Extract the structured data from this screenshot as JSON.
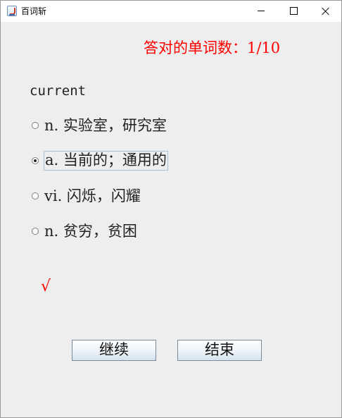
{
  "window": {
    "title": "百词斩"
  },
  "quiz": {
    "score_text": "答对的单词数：1/10",
    "word": "current",
    "options": [
      {
        "label": "n. 实验室，研究室",
        "selected": false
      },
      {
        "label": "a. 当前的；通用的",
        "selected": true
      },
      {
        "label": "vi. 闪烁，闪耀",
        "selected": false
      },
      {
        "label": "n. 贫穷，贫困",
        "selected": false
      }
    ],
    "result_mark": "√"
  },
  "buttons": {
    "continue_label": "继续",
    "end_label": "结束"
  },
  "colors": {
    "accent": "#ff0000",
    "background": "#eeeeee"
  }
}
